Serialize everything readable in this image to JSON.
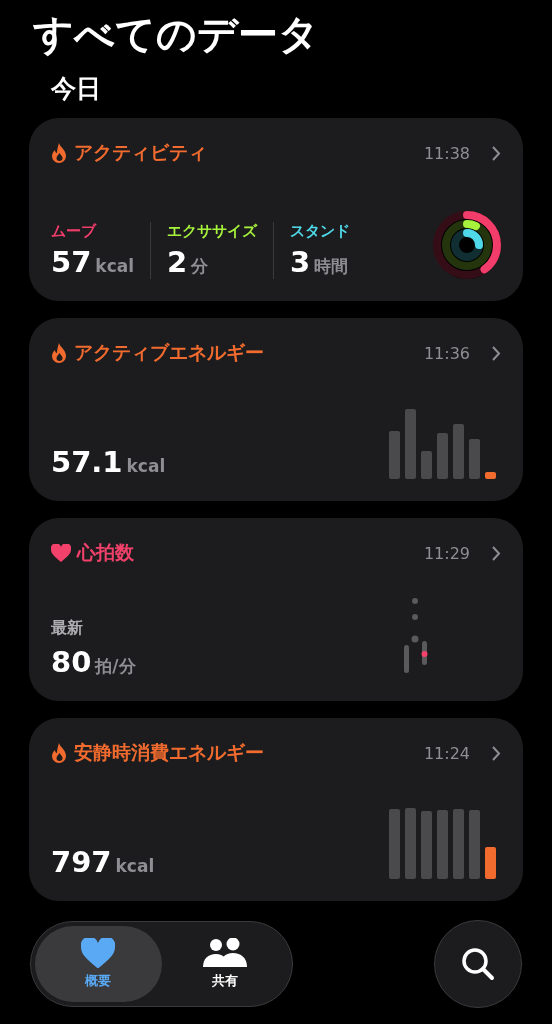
{
  "title": "すべてのデータ",
  "section": "今日",
  "cards": [
    {
      "kind": "activity",
      "color": "#f26b2e",
      "title": "アクティビティ",
      "time": "11:38",
      "metrics": [
        {
          "label": "ムーブ",
          "value": "57",
          "unit": "kcal",
          "color": "#f23c6a",
          "level": 0.4
        },
        {
          "label": "エクササイズ",
          "value": "2",
          "unit": "分",
          "color": "#a6f23c",
          "level": 0.07
        },
        {
          "label": "スタンド",
          "value": "3",
          "unit": "時間",
          "color": "#4fd8e8",
          "level": 0.25
        }
      ]
    },
    {
      "kind": "bars",
      "color": "#f26b2e",
      "title": "アクティブエネルギー",
      "time": "11:36",
      "value": "57.1",
      "unit": "kcal"
    },
    {
      "kind": "latest",
      "color": "#f2416a",
      "title": "心拍数",
      "time": "11:29",
      "caption": "最新",
      "value": "80",
      "unit": "拍/分"
    },
    {
      "kind": "bars",
      "color": "#f26b2e",
      "title": "安静時消費エネルギー",
      "time": "11:24",
      "value": "797",
      "unit": "kcal"
    }
  ],
  "tabs": [
    {
      "label": "概要",
      "selected": true
    },
    {
      "label": "共有",
      "selected": false
    }
  ]
}
